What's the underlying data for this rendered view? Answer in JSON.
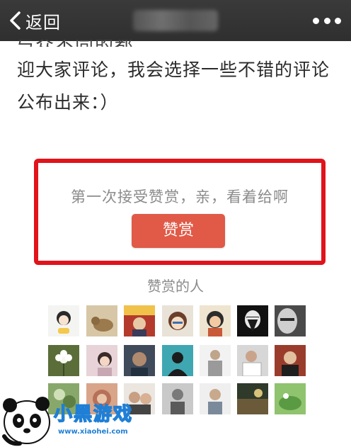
{
  "nav": {
    "back_label": "返回"
  },
  "article": {
    "cut_line": "与众不同的都",
    "text": "迎大家评论，我会选择一些不错的评论公布出来：）"
  },
  "reward": {
    "prompt": "第一次接受赞赏，亲，看着给啊",
    "button_label": "赞赏",
    "rewarders_title": "赞赏的人"
  },
  "watermark": {
    "title": "小黑游戏",
    "url": "www.xiaohei.com"
  },
  "colors": {
    "topbar": "#333333",
    "highlight_border": "#e1131b",
    "reward_button": "#e05a47",
    "watermark_blue": "#1f7fd6"
  }
}
